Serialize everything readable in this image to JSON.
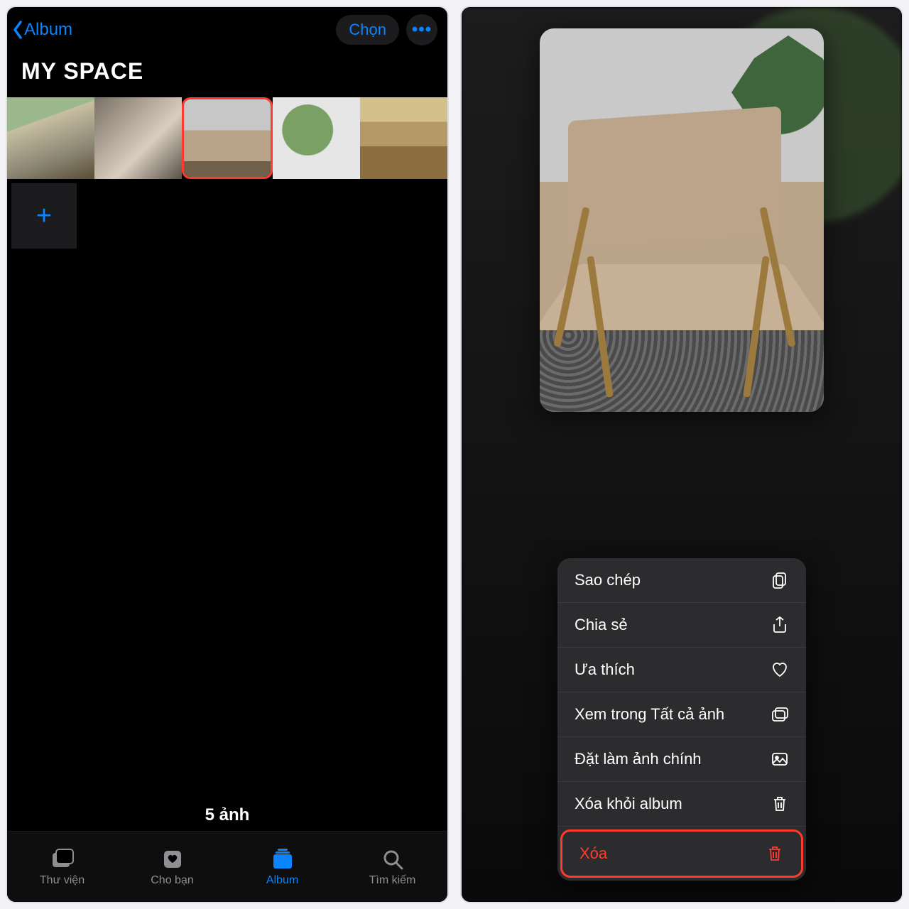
{
  "left": {
    "back_label": "Album",
    "select_label": "Chọn",
    "album_title": "MY SPACE",
    "count_label": "5 ảnh",
    "tabs": {
      "library": "Thư viện",
      "for_you": "Cho bạn",
      "albums": "Album",
      "search": "Tìm kiếm"
    }
  },
  "right": {
    "menu": {
      "copy": "Sao chép",
      "share": "Chia sẻ",
      "favorite": "Ưa thích",
      "view_all": "Xem trong Tất cả ảnh",
      "key_photo": "Đặt làm ảnh chính",
      "remove_album": "Xóa khỏi album",
      "delete": "Xóa"
    }
  }
}
